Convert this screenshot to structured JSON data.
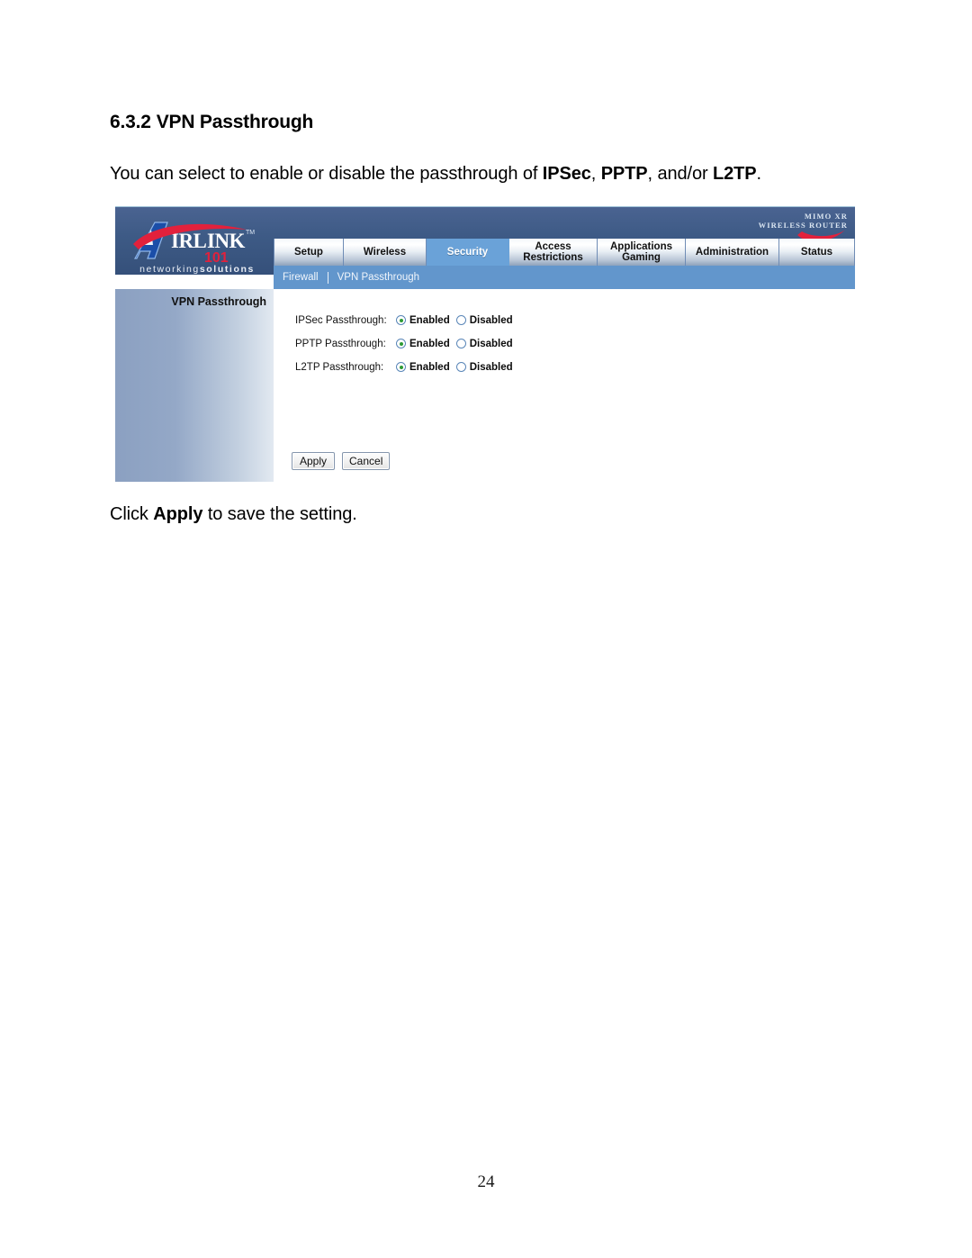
{
  "document": {
    "heading_number": "6.3.2",
    "heading_title": "VPN Passthrough",
    "intro_prefix": "You can select to enable or disable the passthrough of ",
    "intro_term1": "IPSec",
    "intro_mid1": ", ",
    "intro_term2": "PPTP",
    "intro_mid2": ", and/or ",
    "intro_term3": "L2TP",
    "intro_suffix": ".",
    "outro_prefix": "Click ",
    "outro_term": "Apply",
    "outro_suffix": " to save the setting.",
    "page_number": "24"
  },
  "router_ui": {
    "brand": {
      "logo_a": "A",
      "logo_word": "IRLINK",
      "logo_tm": "™",
      "logo_model": "101",
      "tagline_light": "networking",
      "tagline_bold": "solutions",
      "product_line1": "MIMO XR",
      "product_line2": "WIRELESS ROUTER"
    },
    "tabs": [
      {
        "line1": "Setup",
        "line2": "",
        "active": false
      },
      {
        "line1": "Wireless",
        "line2": "",
        "active": false
      },
      {
        "line1": "Security",
        "line2": "",
        "active": true
      },
      {
        "line1": "Access",
        "line2": "Restrictions",
        "active": false
      },
      {
        "line1": "Applications",
        "line2": "Gaming",
        "active": false
      },
      {
        "line1": "Administration",
        "line2": "",
        "active": false
      },
      {
        "line1": "Status",
        "line2": "",
        "active": false
      }
    ],
    "subnav": [
      {
        "label": "Firewall"
      },
      {
        "label": "VPN Passthrough"
      }
    ],
    "side_panel_title": "VPN Passthrough",
    "form_rows": [
      {
        "label": "IPSec Passthrough:",
        "enabled_label": "Enabled",
        "disabled_label": "Disabled",
        "selected": "enabled"
      },
      {
        "label": "PPTP Passthrough:",
        "enabled_label": "Enabled",
        "disabled_label": "Disabled",
        "selected": "enabled"
      },
      {
        "label": "L2TP Passthrough:",
        "enabled_label": "Enabled",
        "disabled_label": "Disabled",
        "selected": "enabled"
      }
    ],
    "buttons": {
      "apply": "Apply",
      "cancel": "Cancel"
    },
    "colors": {
      "header_blue": "#3d5a85",
      "subnav_blue": "#6296cc",
      "active_tab_blue": "#6aa2d8",
      "accent_red": "#e2213c",
      "radio_green": "#2e9b35"
    }
  }
}
